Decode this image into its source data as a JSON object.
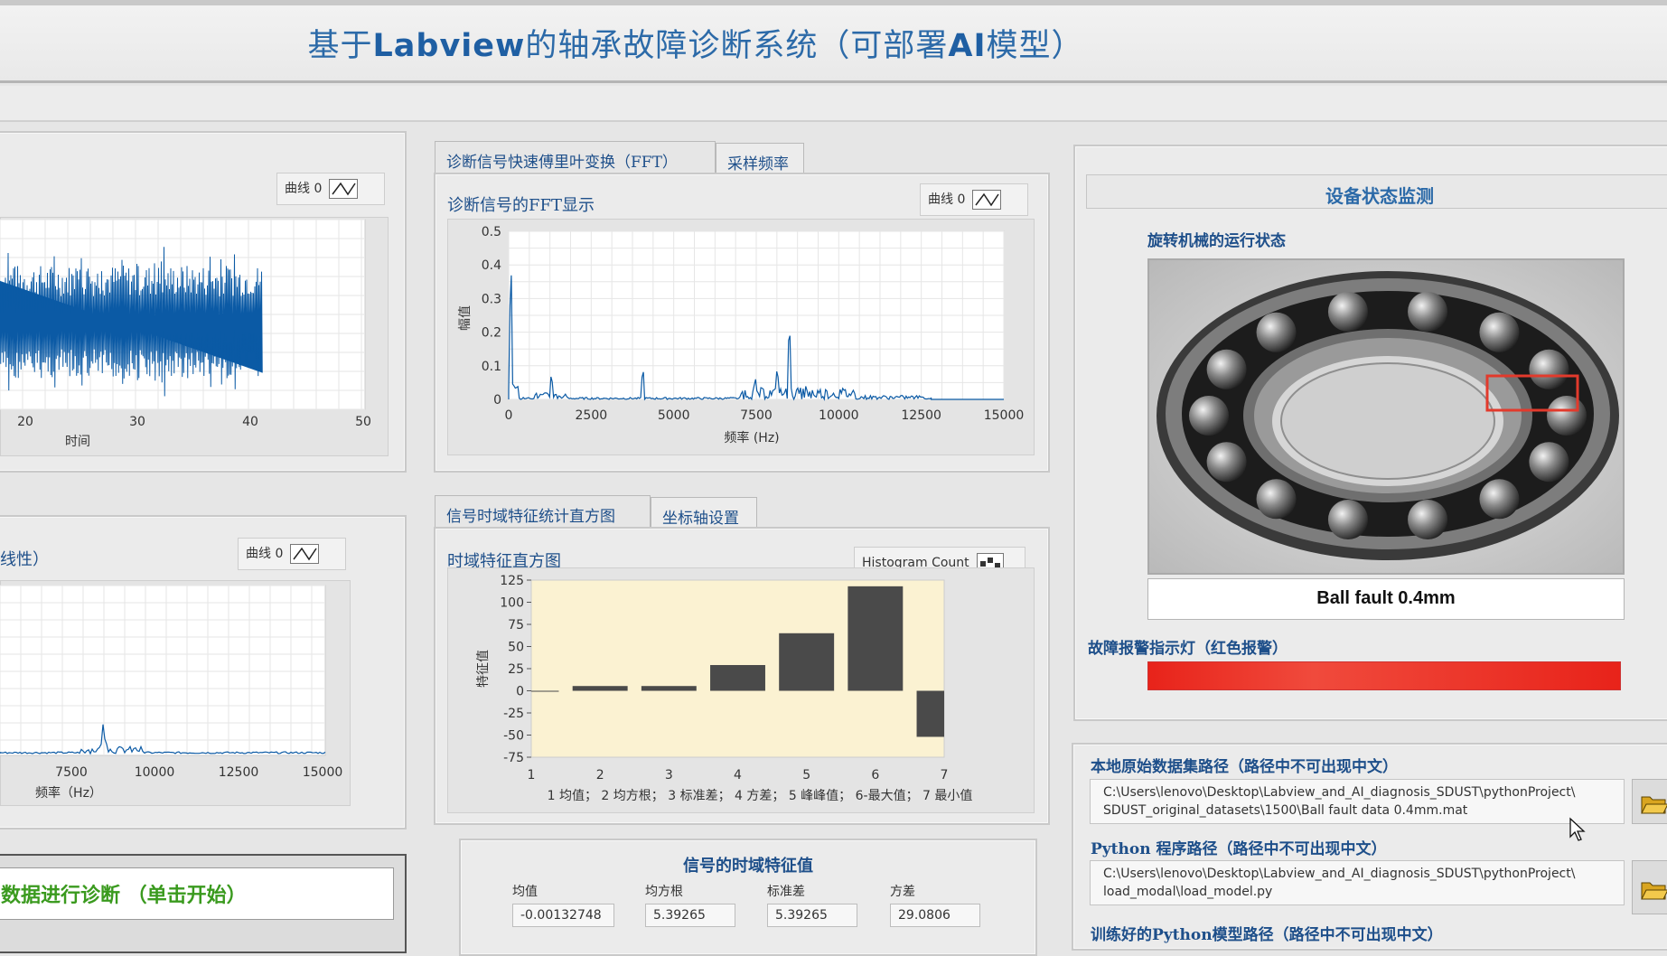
{
  "header": {
    "title_pre": "基于",
    "title_bold1": "Labview",
    "title_mid": "的轴承故障诊断系统（可部署",
    "title_bold2": "AI",
    "title_post": "模型）"
  },
  "left_top": {
    "legend": "曲线 0",
    "xlabel": "时间",
    "xticks": [
      "20",
      "30",
      "40",
      "50"
    ]
  },
  "left_bottom": {
    "label": "线性）",
    "legend": "曲线 0",
    "xlabel": "频率（Hz）",
    "xticks": [
      "7500",
      "10000",
      "12500",
      "15000"
    ]
  },
  "diagnose_button": "数据进行诊断 （单击开始）",
  "fft_tabs": [
    "诊断信号快速傅里叶变换（FFT）",
    "采样频率"
  ],
  "fft_panel": {
    "title": "诊断信号的FFT显示",
    "legend": "曲线 0",
    "ylabel": "幅值",
    "xlabel": "频率 (Hz)",
    "yticks": [
      "0.5",
      "0.4",
      "0.3",
      "0.2",
      "0.1",
      "0"
    ],
    "xticks": [
      "0",
      "2500",
      "5000",
      "7500",
      "10000",
      "12500",
      "15000"
    ]
  },
  "hist_tabs": [
    "信号时域特征统计直方图",
    "坐标轴设置"
  ],
  "hist_panel": {
    "title": "时域特征直方图",
    "legend": "Histogram Count",
    "ylabel": "特征值",
    "caption": "1 均值；  2 均方根；  3 标准差；  4 方差；  5 峰峰值；  6-最大值；  7 最小值"
  },
  "chart_data": [
    {
      "type": "bar",
      "title": "时域特征直方图",
      "ylabel": "特征值",
      "categories": [
        "1",
        "2",
        "3",
        "4",
        "5",
        "6",
        "7"
      ],
      "values": [
        -0.00132748,
        5.39265,
        5.39265,
        29.0806,
        65,
        118,
        -52
      ],
      "ylim": [
        -75,
        125
      ],
      "yticks": [
        "125",
        "100",
        "75",
        "50",
        "25",
        "0",
        "-25",
        "-50",
        "-75"
      ],
      "background": "#fbf2d2",
      "bar_color": "#4a4a4a"
    },
    {
      "type": "line",
      "title": "诊断信号的FFT显示",
      "xlabel": "频率 (Hz)",
      "ylabel": "幅值",
      "xlim": [
        0,
        15000
      ],
      "ylim": [
        0,
        0.5
      ],
      "color": "#0b5aa5",
      "peaks": [
        [
          60,
          0.38
        ],
        [
          1300,
          0.07
        ],
        [
          4050,
          0.09
        ],
        [
          7450,
          0.06
        ],
        [
          8150,
          0.09
        ],
        [
          8500,
          0.2
        ],
        [
          9000,
          0.05
        ],
        [
          12500,
          0.01
        ]
      ]
    }
  ],
  "time_features": {
    "title": "信号的时域特征值",
    "items": [
      {
        "label": "均值",
        "value": "-0.00132748"
      },
      {
        "label": "均方根",
        "value": "5.39265"
      },
      {
        "label": "标准差",
        "value": "5.39265"
      },
      {
        "label": "方差",
        "value": "29.0806"
      }
    ]
  },
  "monitor": {
    "title": "设备状态监测",
    "subtitle": "旋转机械的运行状态",
    "status": "Ball fault 0.4mm",
    "alarm_label": "故障报警指示灯（红色报警）",
    "alarm_color": "#e8231a"
  },
  "paths": {
    "dataset_label": "本地原始数据集路径（路径中不可出现中文）",
    "dataset_line1": "C:\\Users\\lenovo\\Desktop\\Labview_and_AI_diagnosis_SDUST\\pythonProject\\",
    "dataset_line2": "SDUST_original_datasets\\1500\\Ball fault data 0.4mm.mat",
    "python_label": "Python 程序路径（路径中不可出现中文）",
    "python_line1": "C:\\Users\\lenovo\\Desktop\\Labview_and_AI_diagnosis_SDUST\\pythonProject\\",
    "python_line2": "load_modal\\load_model.py",
    "model_label": "训练好的Python模型路径（路径中不可出现中文）"
  }
}
